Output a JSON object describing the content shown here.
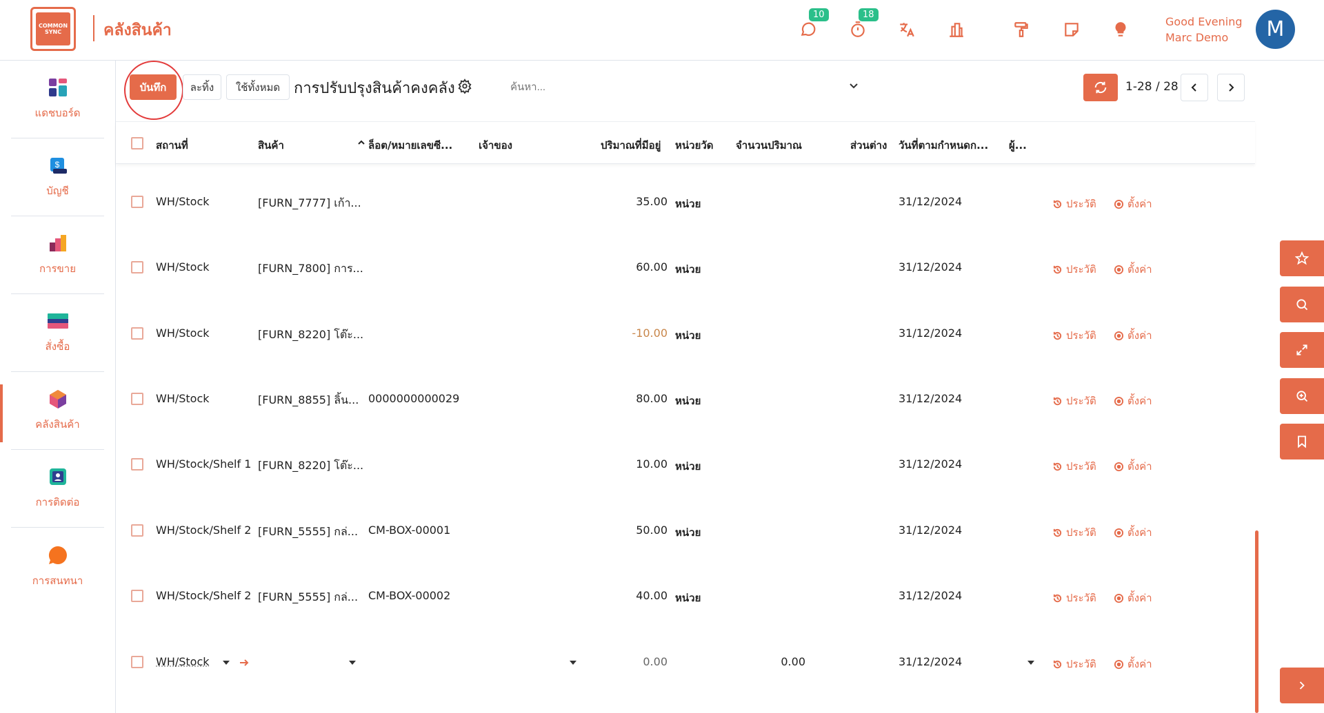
{
  "app": {
    "logo_text": "COMMON SYNC",
    "module_title": "คลังสินค้า"
  },
  "header": {
    "chat_badge": "10",
    "timer_badge": "18",
    "greeting": "Good Evening",
    "user_name": "Marc Demo",
    "avatar_initial": "M"
  },
  "sidebar": {
    "items": [
      {
        "label": "แดชบอร์ด",
        "icon": "dashboard-icon"
      },
      {
        "label": "บัญชี",
        "icon": "accounting-icon"
      },
      {
        "label": "การขาย",
        "icon": "sales-icon"
      },
      {
        "label": "สั่งซื้อ",
        "icon": "purchase-icon"
      },
      {
        "label": "คลังสินค้า",
        "icon": "inventory-icon"
      },
      {
        "label": "การติดต่อ",
        "icon": "contacts-icon"
      },
      {
        "label": "การสนทนา",
        "icon": "discuss-icon"
      }
    ]
  },
  "controls": {
    "save_label": "บันทึก",
    "discard_label": "ละทิ้ง",
    "apply_all_label": "ใช้ทั้งหมด",
    "page_title": "การปรับปรุงสินค้าคงคลัง",
    "search_placeholder": "ค้นหา...",
    "pager": "1-28 / 28"
  },
  "table": {
    "headers": {
      "location": "สถานที่",
      "product": "สินค้า",
      "lot": "ล็อต/หมายเลขซี...",
      "owner": "เจ้าของ",
      "on_hand": "ปริมาณที่มีอยู่",
      "uom": "หน่วยวัด",
      "counted": "จำนวนปริมาณ",
      "difference": "ส่วนต่าง",
      "scheduled": "วันที่ตามกำหนดก...",
      "user": "ผู้..."
    },
    "history_label": "ประวัติ",
    "set_label": "ตั้งค่า",
    "rows": [
      {
        "location": "WH/Stock",
        "product": "[FURN_7777] เก้า...",
        "lot": "",
        "qty": "35.00",
        "uom": "หน่วย",
        "date": "31/12/2024",
        "negative": false
      },
      {
        "location": "WH/Stock",
        "product": "[FURN_7800] การ...",
        "lot": "",
        "qty": "60.00",
        "uom": "หน่วย",
        "date": "31/12/2024",
        "negative": false
      },
      {
        "location": "WH/Stock",
        "product": "[FURN_8220] โต๊ะ...",
        "lot": "",
        "qty": "-10.00",
        "uom": "หน่วย",
        "date": "31/12/2024",
        "negative": true
      },
      {
        "location": "WH/Stock",
        "product": "[FURN_8855] ลิ้น...",
        "lot": "0000000000029",
        "qty": "80.00",
        "uom": "หน่วย",
        "date": "31/12/2024",
        "negative": false
      },
      {
        "location": "WH/Stock/Shelf 1",
        "product": "[FURN_8220] โต๊ะ...",
        "lot": "",
        "qty": "10.00",
        "uom": "หน่วย",
        "date": "31/12/2024",
        "negative": false
      },
      {
        "location": "WH/Stock/Shelf 2",
        "product": "[FURN_5555] กล่...",
        "lot": "CM-BOX-00001",
        "qty": "50.00",
        "uom": "หน่วย",
        "date": "31/12/2024",
        "negative": false
      },
      {
        "location": "WH/Stock/Shelf 2",
        "product": "[FURN_5555] กล่...",
        "lot": "CM-BOX-00002",
        "qty": "40.00",
        "uom": "หน่วย",
        "date": "31/12/2024",
        "negative": false
      }
    ],
    "new_row": {
      "location": "WH/Stock",
      "qty": "0.00",
      "counted": "0.00",
      "date": "31/12/2024"
    }
  }
}
